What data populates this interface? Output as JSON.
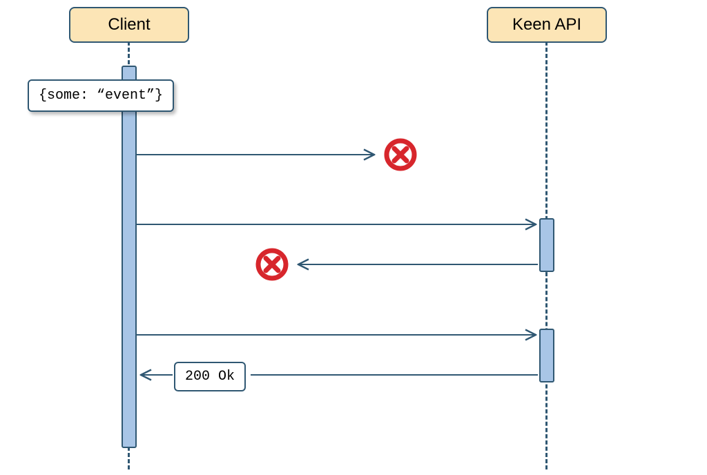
{
  "participants": {
    "client": {
      "label": "Client"
    },
    "server": {
      "label": "Keen API"
    }
  },
  "notes": {
    "event": "{some: “event”}",
    "ok": "200 Ok"
  },
  "icons": {
    "fail": "error-icon"
  },
  "colors": {
    "stroke": "#2f5772",
    "fill_box": "#fce5b6",
    "fill_activation": "#a8c5e6",
    "error": "#d7262c"
  }
}
